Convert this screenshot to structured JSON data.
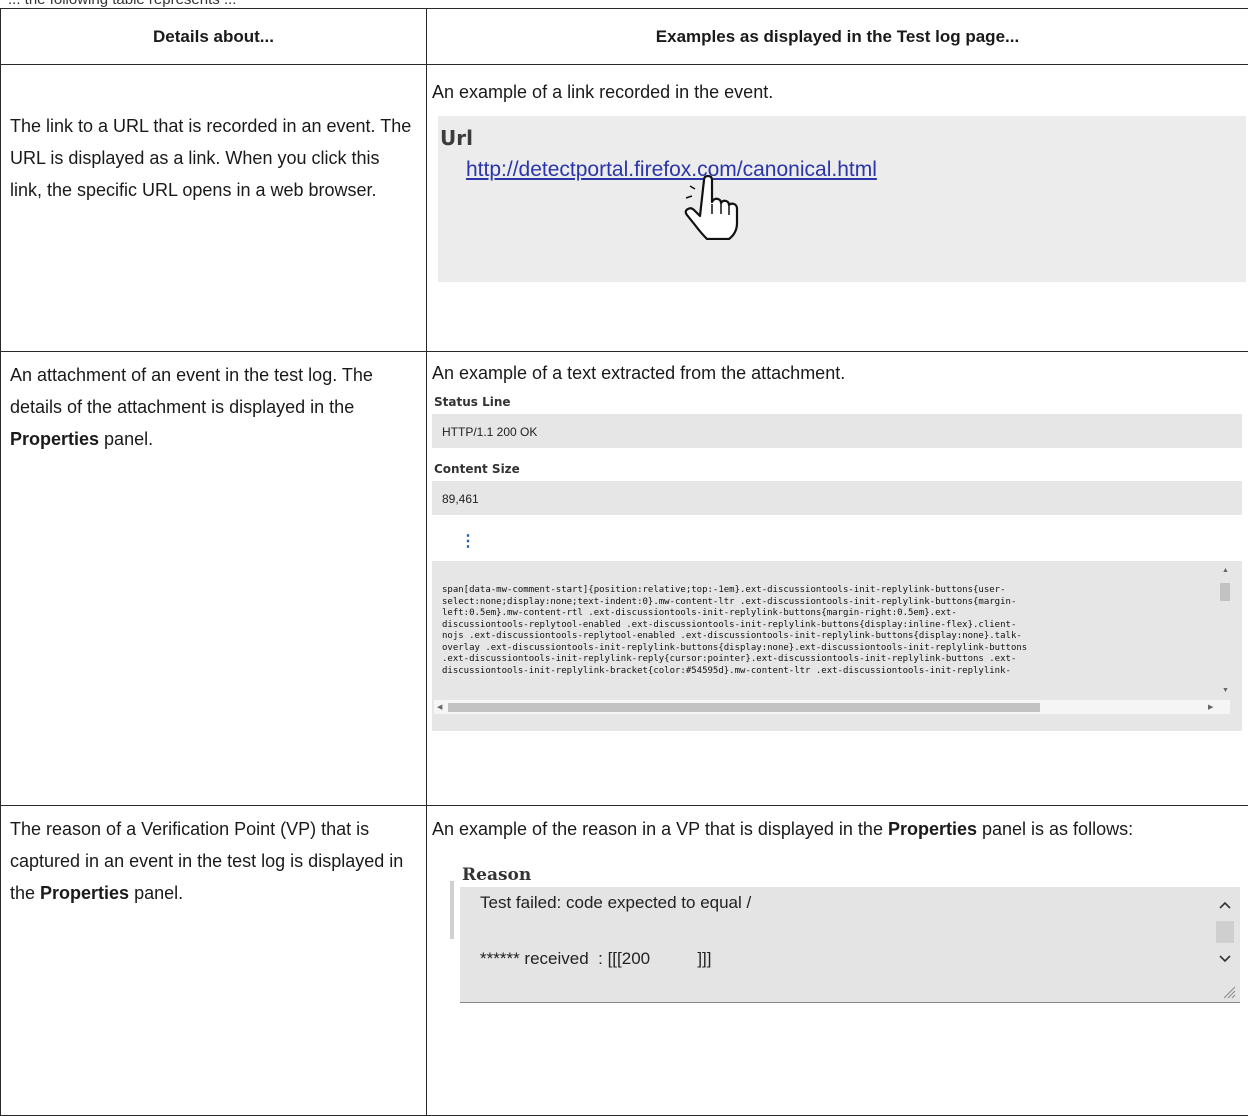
{
  "caption_cut": "... the following table represents ...",
  "table": {
    "header": {
      "col1": "Details about...",
      "col2": "Examples as displayed in the Test log page..."
    },
    "rows": [
      {
        "details": "The link to a URL that is recorded in an event. The URL is displayed as a link. When you click this link, the specific URL opens in a web browser.",
        "example_intro": "An example of a link recorded in the event.",
        "url_label": "Url",
        "url_link": "http://detectportal.firefox.com/canonical.html",
        "icon": "hand-pointer-icon"
      },
      {
        "details_prefix": "An attachment of an event in the test log. The details of the attachment is displayed in the ",
        "details_bold": "Properties",
        "details_suffix": " panel.",
        "example_intro": "An example of a text extracted from the attachment.",
        "status_line_label": "Status Line",
        "status_line_value": "HTTP/1.1 200 OK",
        "content_size_label": "Content Size",
        "content_size_value": "89,461",
        "kebab_icon": "vertical-ellipsis-icon",
        "code_text": "span[data-mw-comment-start]{position:relative;top:-1em}.ext-discussiontools-init-replylink-buttons{user-\nselect:none;display:none;text-indent:0}.mw-content-ltr .ext-discussiontools-init-replylink-buttons{margin-\nleft:0.5em}.mw-content-rtl .ext-discussiontools-init-replylink-buttons{margin-right:0.5em}.ext-\ndiscussiontools-replytool-enabled .ext-discussiontools-init-replylink-buttons{display:inline-flex}.client-\nnojs .ext-discussiontools-replytool-enabled .ext-discussiontools-init-replylink-buttons{display:none}.talk-\noverlay .ext-discussiontools-init-replylink-buttons{display:none}.ext-discussiontools-init-replylink-buttons\n.ext-discussiontools-init-replylink-reply{cursor:pointer}.ext-discussiontools-init-replylink-buttons .ext-\ndiscussiontools-init-replylink-bracket{color:#54595d}.mw-content-ltr .ext-discussiontools-init-replylink-"
      },
      {
        "details_prefix": "The reason of a Verification Point (VP) that is captured in an event in the test log is displayed in the ",
        "details_bold": "Properties",
        "details_suffix": " panel.",
        "example_prefix": "An example of the reason in a VP that is displayed in the ",
        "example_bold": "Properties",
        "example_suffix": " panel is as follows:",
        "reason_label": "Reason",
        "reason_line1": "Test failed: code expected to equal /",
        "reason_line2": "****** received  : [[[200          ]]]"
      }
    ]
  },
  "colors": {
    "link": "#2a35a8",
    "panel_bg": "#e6e6e6",
    "kebab": "#1a5fa8"
  }
}
